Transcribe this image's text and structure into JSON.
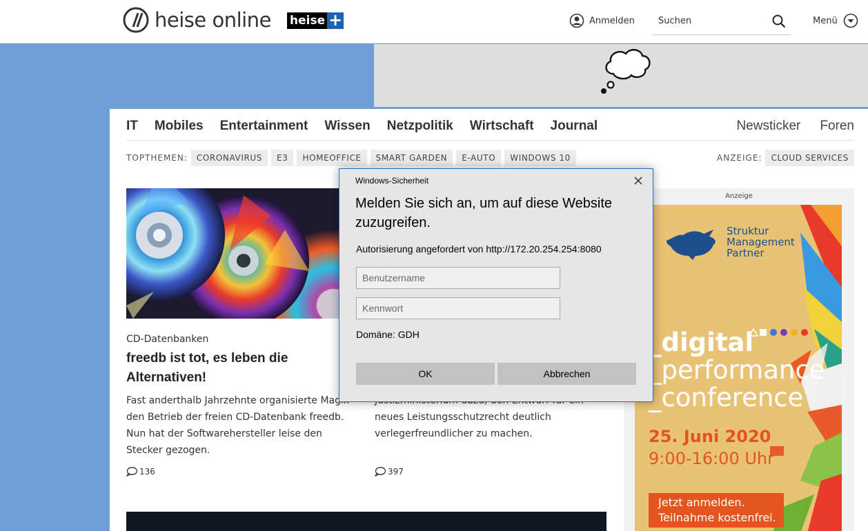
{
  "header": {
    "logo_text": "heise online",
    "heiseplus_text": "heise",
    "heiseplus_plus": "+",
    "login_label": "Anmelden",
    "search_placeholder": "Suchen",
    "menu_label": "Menü"
  },
  "nav": {
    "items": [
      "IT",
      "Mobiles",
      "Entertainment",
      "Wissen",
      "Netzpolitik",
      "Wirtschaft",
      "Journal"
    ],
    "right_items": [
      "Newsticker",
      "Foren"
    ]
  },
  "topics": {
    "label": "TOPTHEMEN:",
    "tags": [
      "CORONAVIRUS",
      "E3",
      "HOMEOFFICE",
      "SMART GARDEN",
      "E-AUTO",
      "WINDOWS 10"
    ],
    "ad_label": "ANZEIGE:",
    "ad_tag": "CLOUD SERVICES"
  },
  "articles": [
    {
      "kicker": "CD-Datenbanken",
      "headline": "freedb ist tot, es leben die Alternativen!",
      "teaser": "Fast anderthalb Jahrzehnte organisierte Magix den Betrieb der freien CD-Datenbank freedb. Nun hat der Softwarehersteller leise den Stecker gezogen.",
      "comments": "136"
    },
    {
      "teaser": "Justizministerium dazu, den Entwurf für ein neues Leistungsschutzrecht deutlich verlegerfreundlicher zu machen.",
      "comments": "397"
    }
  ],
  "sidebar_ad": {
    "label": "Anzeige",
    "company_line1": "Struktur",
    "company_line2": "Management",
    "company_line3": "Partner",
    "line1": "_digital",
    "line2": "_performance",
    "line3": "_conference",
    "date": "25. Juni 2020",
    "time": "9:00-16:00 Uhr",
    "cta_line1": "Jetzt anmelden.",
    "cta_line2": "Teilnahme kostenfrei."
  },
  "dialog": {
    "title": "Windows-Sicherheit",
    "heading": "Melden Sie sich an, um auf diese Website zuzugreifen.",
    "auth_text": "Autorisierung angefordert von http://172.20.254.254:8080",
    "username_placeholder": "Benutzername",
    "password_placeholder": "Kennwort",
    "domain_text": "Domäne: GDH",
    "ok_label": "OK",
    "cancel_label": "Abbrechen"
  }
}
